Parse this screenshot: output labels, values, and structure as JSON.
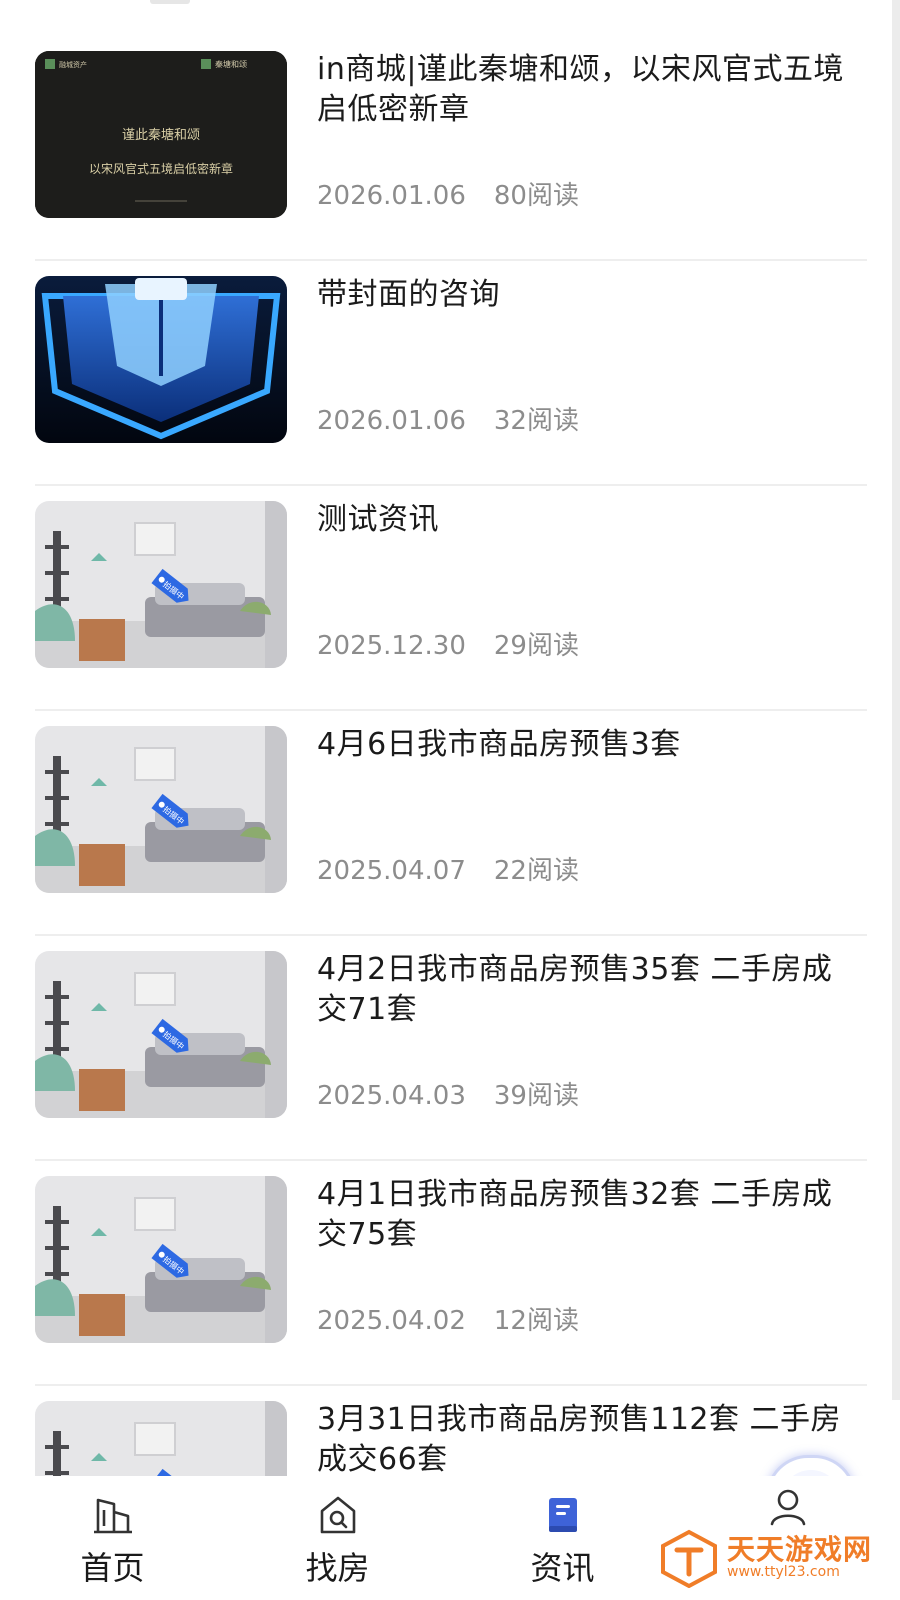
{
  "news": [
    {
      "title": "in商城|谨此秦塘和颂，以宋风官式五境启低密新章",
      "date": "2026.01.06",
      "views": "80阅读",
      "thumb": "poster-dark",
      "poster": {
        "brand_left": "融城资产",
        "brand_right": "秦塘和颂",
        "line1": "谨此秦塘和颂",
        "line2": "以宋风官式五境启低密新章"
      }
    },
    {
      "title": "带封面的咨询",
      "date": "2026.01.06",
      "views": "32阅读",
      "thumb": "shield-blue"
    },
    {
      "title": "测试资讯",
      "date": "2025.12.30",
      "views": "29阅读",
      "thumb": "room-photo"
    },
    {
      "title": "4月6日我市商品房预售3套",
      "date": "2025.04.07",
      "views": "22阅读",
      "thumb": "room-photo"
    },
    {
      "title": "4月2日我市商品房预售35套 二手房成交71套",
      "date": "2025.04.03",
      "views": "39阅读",
      "thumb": "room-photo"
    },
    {
      "title": "4月1日我市商品房预售32套 二手房成交75套",
      "date": "2025.04.02",
      "views": "12阅读",
      "thumb": "room-photo"
    },
    {
      "title": "3月31日我市商品房预售112套 二手房成交66套",
      "date": "",
      "views": "",
      "thumb": "room-photo"
    }
  ],
  "tag_label": "拍摄中",
  "tabs": [
    {
      "label": "首页",
      "icon": "building-icon",
      "active": false
    },
    {
      "label": "找房",
      "icon": "house-search-icon",
      "active": false
    },
    {
      "label": "资讯",
      "icon": "book-icon",
      "active": true
    },
    {
      "label": "",
      "icon": "user-icon",
      "active": false
    }
  ],
  "watermark": {
    "text": "天天游戏网",
    "url": "www.ttyl23.com"
  },
  "colors": {
    "accent": "#3e63d8",
    "meta": "#8c8c8c",
    "divider": "#eeeeee",
    "watermark": "#f07d28"
  }
}
